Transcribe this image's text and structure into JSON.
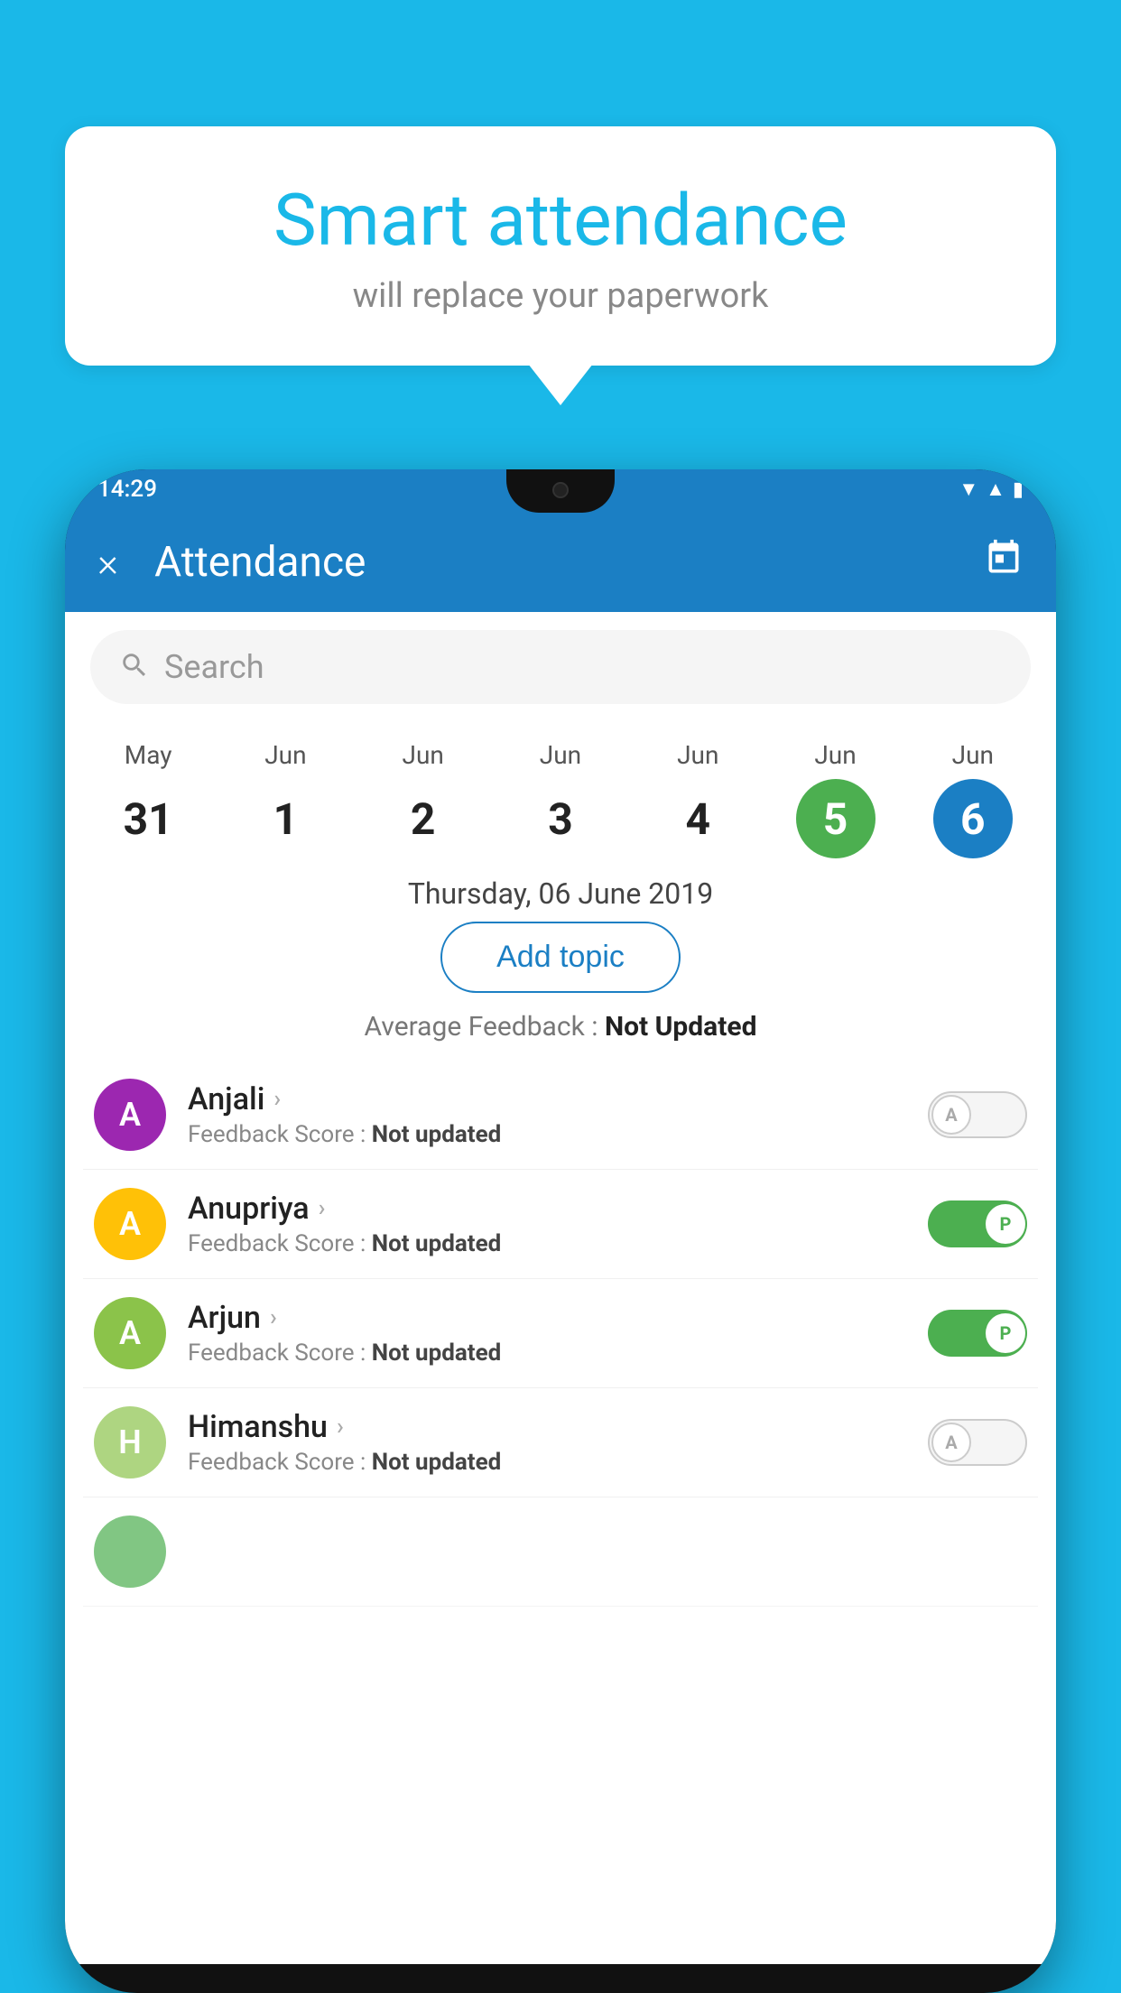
{
  "background_color": "#1ab8e8",
  "bubble": {
    "title": "Smart attendance",
    "subtitle": "will replace your paperwork"
  },
  "status_bar": {
    "time": "14:29",
    "wifi_icon": "▼",
    "signal_icon": "▲",
    "battery_icon": "▮"
  },
  "header": {
    "close_label": "×",
    "title": "Attendance",
    "calendar_icon": "📅"
  },
  "search": {
    "placeholder": "Search"
  },
  "calendar": {
    "days": [
      {
        "month": "May",
        "date": "31",
        "style": "normal"
      },
      {
        "month": "Jun",
        "date": "1",
        "style": "normal"
      },
      {
        "month": "Jun",
        "date": "2",
        "style": "normal"
      },
      {
        "month": "Jun",
        "date": "3",
        "style": "normal"
      },
      {
        "month": "Jun",
        "date": "4",
        "style": "normal"
      },
      {
        "month": "Jun",
        "date": "5",
        "style": "today"
      },
      {
        "month": "Jun",
        "date": "6",
        "style": "selected"
      }
    ]
  },
  "selected_date": "Thursday, 06 June 2019",
  "add_topic_label": "Add topic",
  "avg_feedback_label": "Average Feedback : ",
  "avg_feedback_value": "Not Updated",
  "students": [
    {
      "name": "Anjali",
      "avatar_letter": "A",
      "avatar_color": "#9c27b0",
      "feedback_label": "Feedback Score : ",
      "feedback_value": "Not updated",
      "toggle": "absent"
    },
    {
      "name": "Anupriya",
      "avatar_letter": "A",
      "avatar_color": "#ffc107",
      "feedback_label": "Feedback Score : ",
      "feedback_value": "Not updated",
      "toggle": "present"
    },
    {
      "name": "Arjun",
      "avatar_letter": "A",
      "avatar_color": "#8bc34a",
      "feedback_label": "Feedback Score : ",
      "feedback_value": "Not updated",
      "toggle": "present"
    },
    {
      "name": "Himanshu",
      "avatar_letter": "H",
      "avatar_color": "#aed581",
      "feedback_label": "Feedback Score : ",
      "feedback_value": "Not updated",
      "toggle": "absent"
    }
  ],
  "partial_student": {
    "avatar_color": "#4caf50",
    "toggle": "present"
  }
}
